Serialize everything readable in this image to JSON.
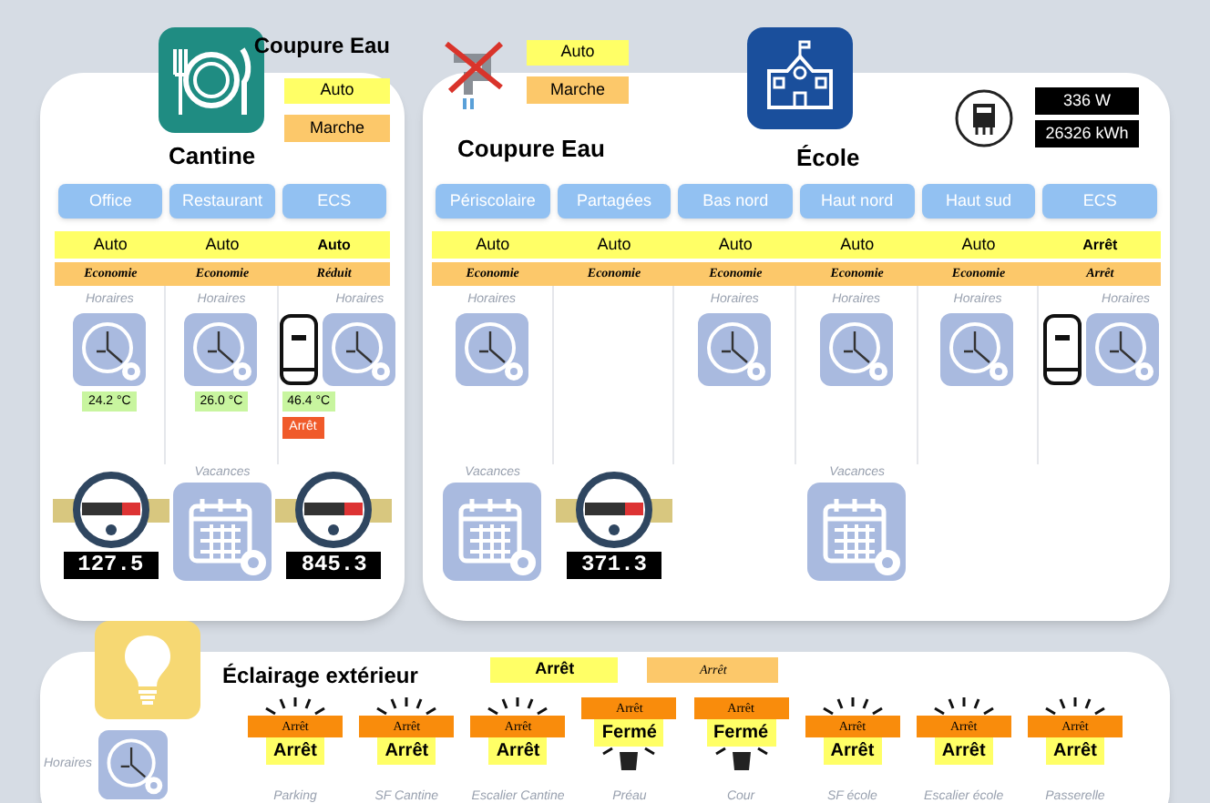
{
  "cantine": {
    "title": "Cantine",
    "water_cut": {
      "title": "Coupure Eau",
      "mode": "Auto",
      "state": "Marche"
    },
    "zones": [
      {
        "name": "Office",
        "kind": "heating",
        "mode": "Auto",
        "regime": "Economie",
        "schedule": "Horaires",
        "temperature": "24.2 °C",
        "below": {
          "kind": "meter",
          "reading": "127.5"
        }
      },
      {
        "name": "Restaurant",
        "kind": "heating",
        "mode": "Auto",
        "regime": "Economie",
        "schedule": "Horaires",
        "temperature": "26.0 °C",
        "below": {
          "kind": "calendar",
          "label": "Vacances"
        }
      },
      {
        "name": "ECS",
        "kind": "hot_water",
        "mode": "Auto",
        "regime": "Réduit",
        "schedule": "Horaires",
        "temperature": "46.4 °C",
        "status": "Arrêt",
        "below": {
          "kind": "meter",
          "reading": "845.3"
        }
      }
    ]
  },
  "ecole": {
    "title": "École",
    "water_cut": {
      "title": "Coupure Eau",
      "mode": "Auto",
      "state": "Marche"
    },
    "power": "336 W",
    "energy": "26326 kWh",
    "zones": [
      {
        "name": "Périscolaire",
        "kind": "heating",
        "mode": "Auto",
        "regime": "Economie",
        "schedule": "Horaires",
        "below": {
          "kind": "calendar",
          "label": "Vacances"
        }
      },
      {
        "name": "Partagées",
        "kind": "heating",
        "mode": "Auto",
        "regime": "Economie",
        "below": {
          "kind": "meter",
          "reading": "371.3"
        }
      },
      {
        "name": "Bas nord",
        "kind": "heating",
        "mode": "Auto",
        "regime": "Economie",
        "schedule": "Horaires"
      },
      {
        "name": "Haut nord",
        "kind": "heating",
        "mode": "Auto",
        "regime": "Economie",
        "schedule": "Horaires",
        "below": {
          "kind": "calendar",
          "label": "Vacances"
        }
      },
      {
        "name": "Haut sud",
        "kind": "heating",
        "mode": "Auto",
        "regime": "Economie",
        "schedule": "Horaires"
      },
      {
        "name": "ECS",
        "kind": "hot_water",
        "mode": "Arrêt",
        "regime": "Arrêt",
        "schedule": "Horaires"
      }
    ]
  },
  "lighting": {
    "title": "Éclairage extérieur",
    "schedule": "Horaires",
    "mode": "Arrêt",
    "regime": "Arrêt",
    "lights": [
      {
        "name": "Parking",
        "kind": "dusk",
        "command": "Arrêt",
        "state": "Arrêt"
      },
      {
        "name": "SF Cantine",
        "kind": "dusk",
        "command": "Arrêt",
        "state": "Arrêt"
      },
      {
        "name": "Escalier Cantine",
        "kind": "dusk",
        "command": "Arrêt",
        "state": "Arrêt"
      },
      {
        "name": "Préau",
        "kind": "bulb",
        "command": "Arrêt",
        "state": "Fermé"
      },
      {
        "name": "Cour",
        "kind": "bulb",
        "command": "Arrêt",
        "state": "Fermé"
      },
      {
        "name": "SF école",
        "kind": "dusk",
        "command": "Arrêt",
        "state": "Arrêt"
      },
      {
        "name": "Escalier école",
        "kind": "dusk",
        "command": "Arrêt",
        "state": "Arrêt"
      },
      {
        "name": "Passerelle",
        "kind": "dusk",
        "command": "Arrêt",
        "state": "Arrêt"
      }
    ]
  }
}
